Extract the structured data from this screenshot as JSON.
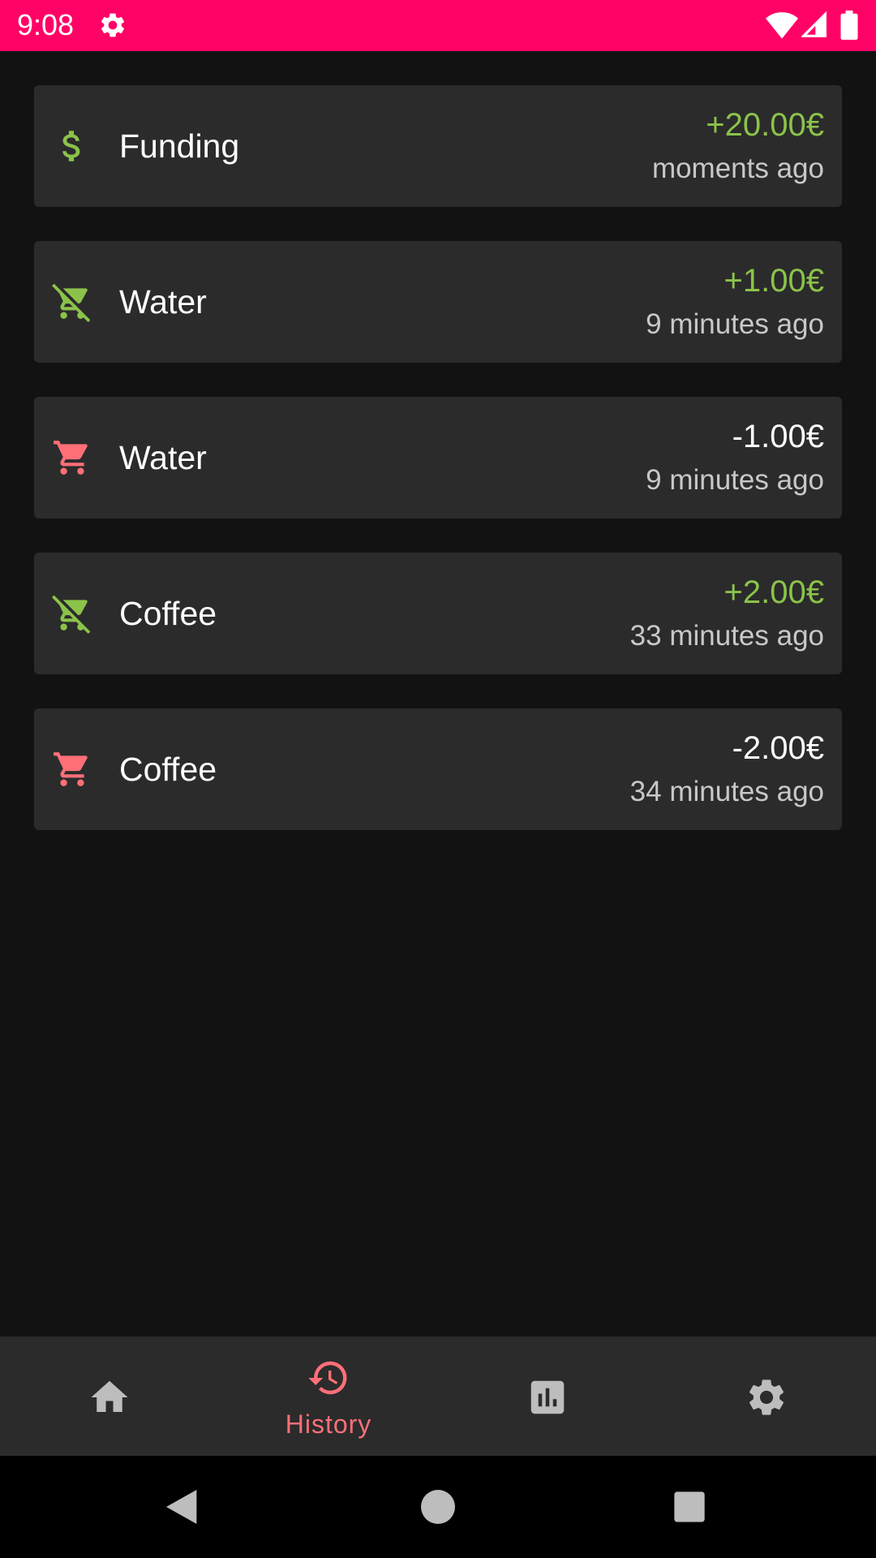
{
  "status_bar": {
    "time": "9:08",
    "background": "#ff0266",
    "icons": [
      "gear-icon",
      "wifi-icon",
      "signal-icon",
      "battery-icon"
    ]
  },
  "colors": {
    "positive": "#8bc34a",
    "negative_icon": "#ff6f78",
    "card_background": "#2b2b2b",
    "page_background": "#121212",
    "nav_active": "#ff6f78",
    "nav_inactive": "#bdbdbd"
  },
  "history": [
    {
      "icon": "dollar-icon",
      "title": "Funding",
      "amount": "+20.00€",
      "time": "moments ago",
      "positive": true
    },
    {
      "icon": "cart-off-icon",
      "title": "Water",
      "amount": "+1.00€",
      "time": "9 minutes ago",
      "positive": true
    },
    {
      "icon": "cart-icon",
      "title": "Water",
      "amount": "-1.00€",
      "time": "9 minutes ago",
      "positive": false
    },
    {
      "icon": "cart-off-icon",
      "title": "Coffee",
      "amount": "+2.00€",
      "time": "33 minutes ago",
      "positive": true
    },
    {
      "icon": "cart-icon",
      "title": "Coffee",
      "amount": "-2.00€",
      "time": "34 minutes ago",
      "positive": false
    }
  ],
  "bottom_nav": {
    "items": [
      {
        "icon": "home-icon",
        "label": "",
        "active": false
      },
      {
        "icon": "history-icon",
        "label": "History",
        "active": true
      },
      {
        "icon": "bar-chart-icon",
        "label": "",
        "active": false
      },
      {
        "icon": "settings-icon",
        "label": "",
        "active": false
      }
    ]
  },
  "system_nav": [
    "back-icon",
    "home-circle-icon",
    "recents-icon"
  ]
}
